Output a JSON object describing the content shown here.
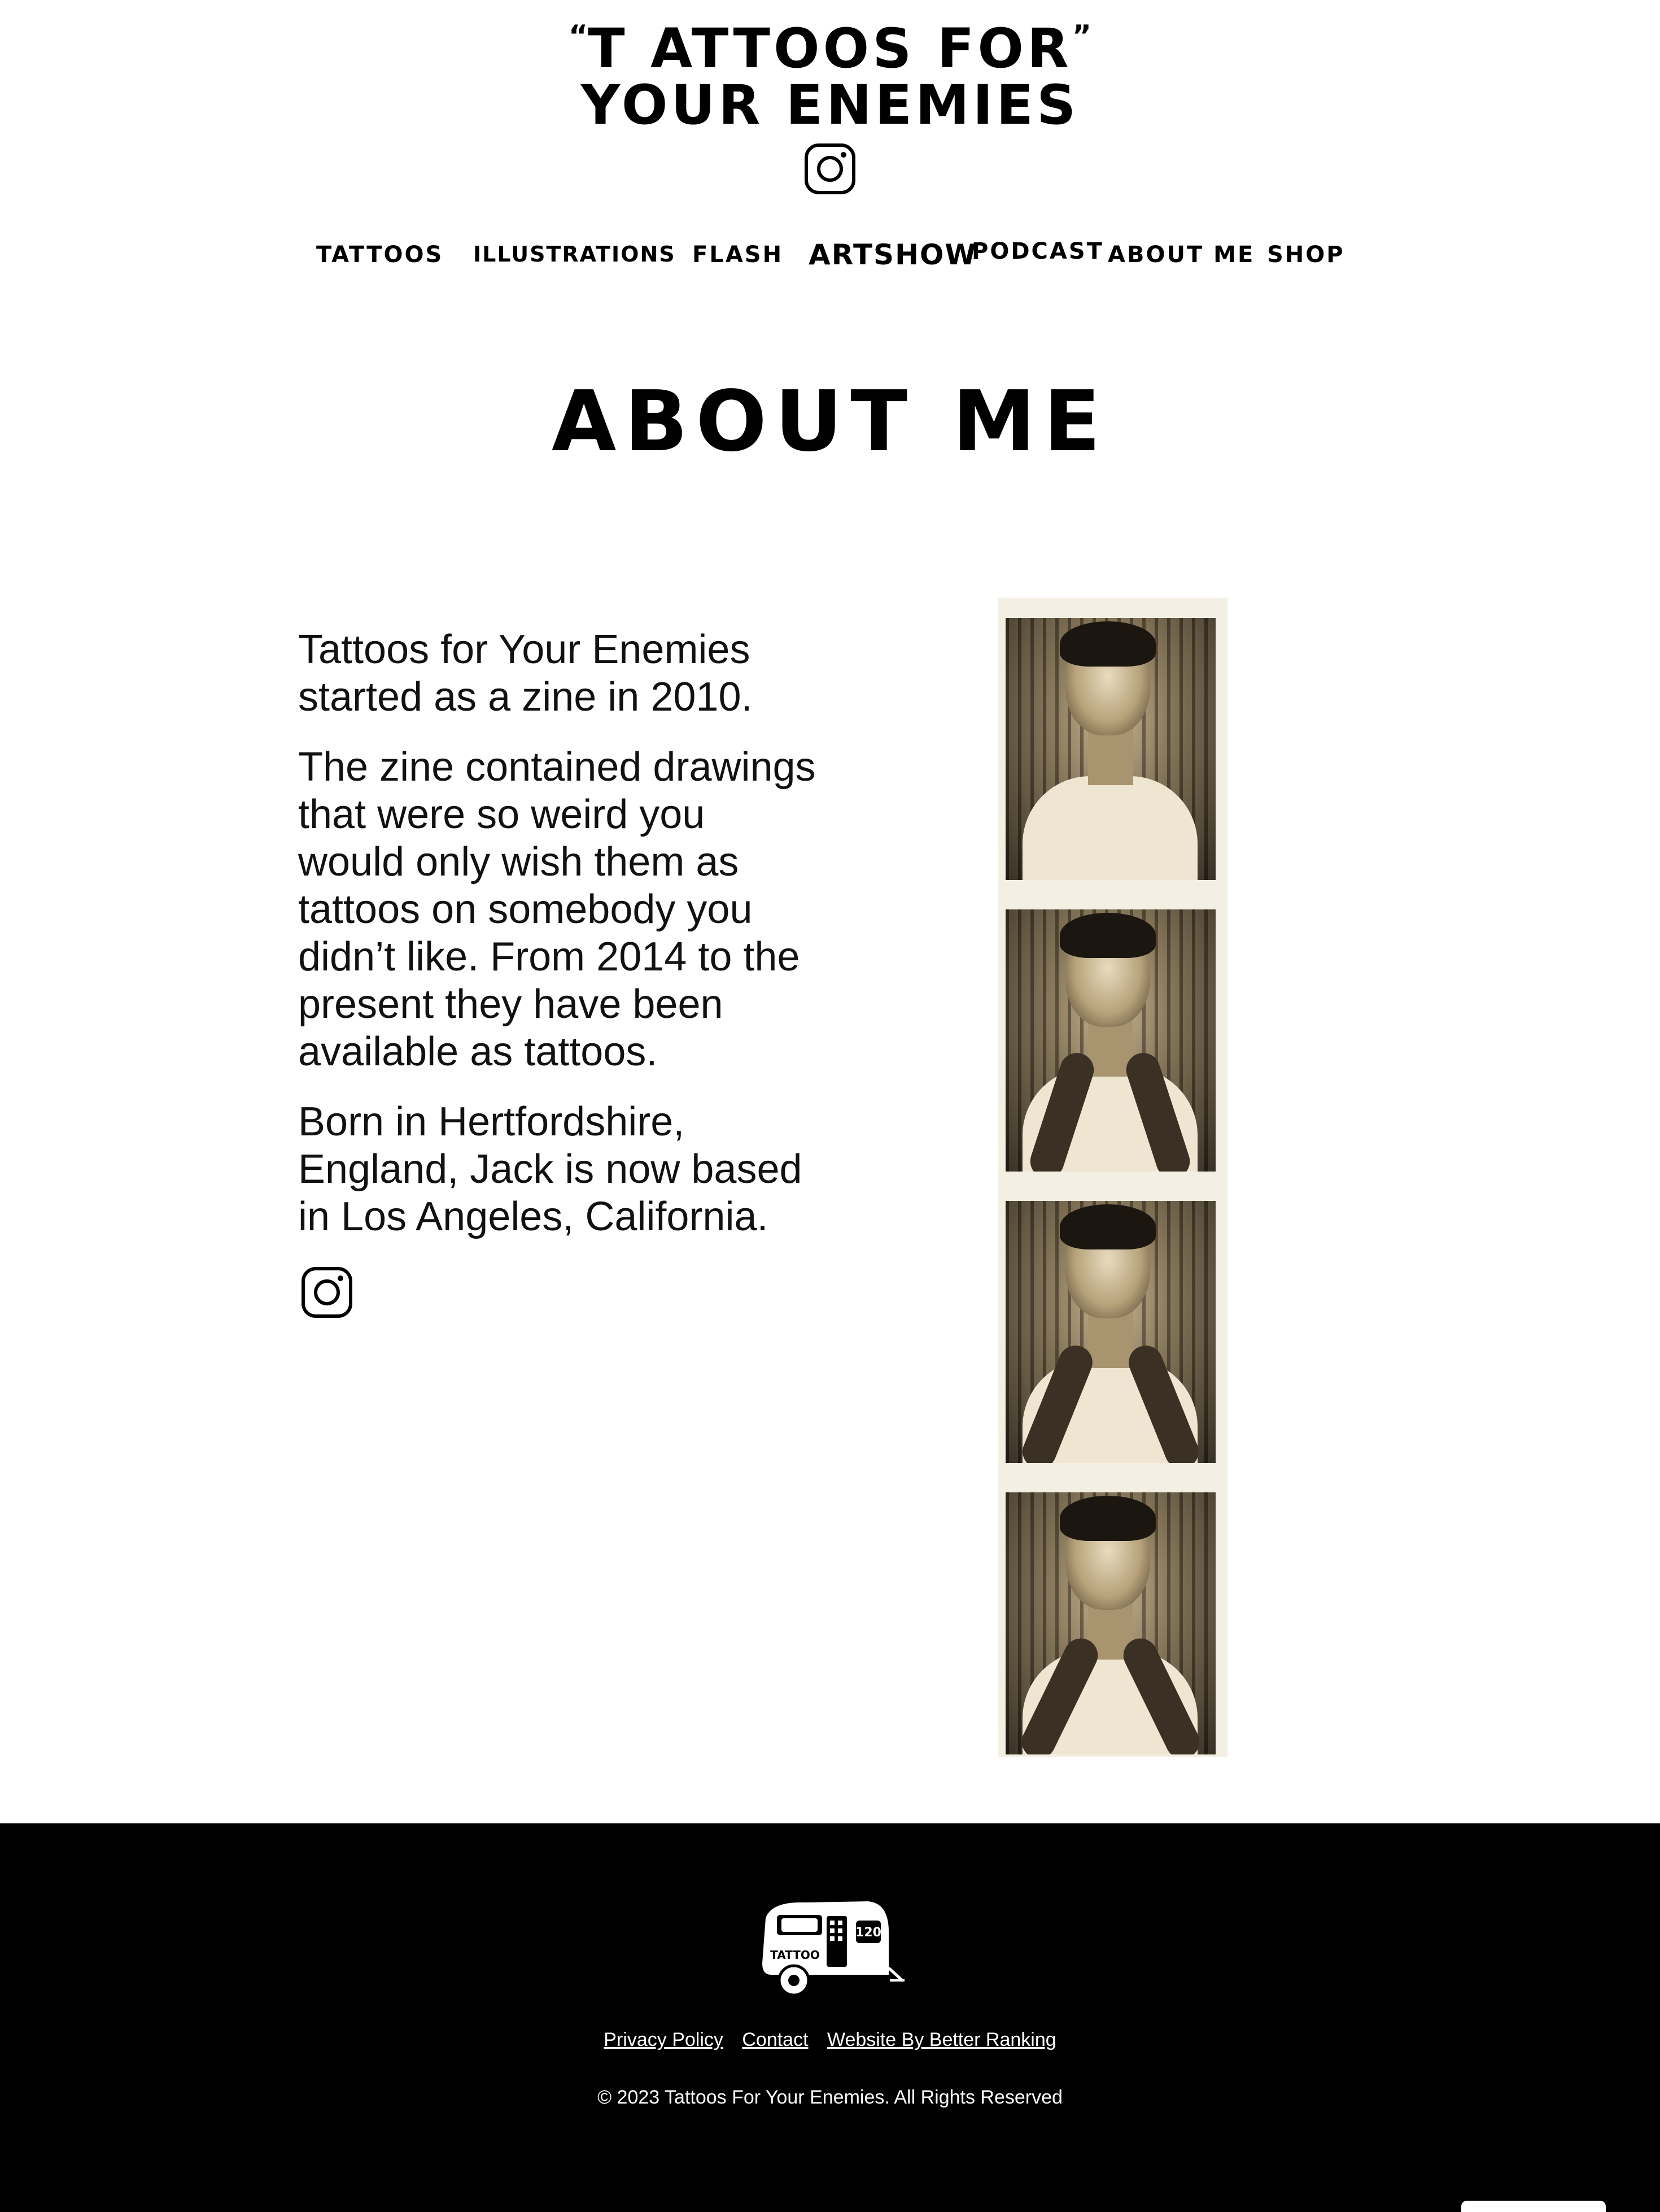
{
  "header": {
    "logo_line1": "T ATTOOS FOR",
    "logo_line2": "YOUR ENEMIES",
    "open_quote": "“",
    "close_quote": "”",
    "instagram_icon": "instagram-icon"
  },
  "nav": {
    "items": [
      {
        "label": "TATTOOS"
      },
      {
        "label": "ILLUSTRATIONS"
      },
      {
        "label": "FLASH"
      },
      {
        "label": "ARTSHOW"
      },
      {
        "label": "PODCAST"
      },
      {
        "label": "ABOUT ME"
      },
      {
        "label": "SHOP"
      }
    ]
  },
  "main": {
    "title": "ABOUT ME",
    "paragraphs": [
      "Tattoos for Your Enemies started as a zine in 2010.",
      "The zine contained drawings that were so weird you would only wish them as tattoos on somebody you didn’t like. From 2014 to the present they have been available as tattoos.",
      "Born in Hertfordshire, England, Jack is now based in Los Angeles, California."
    ],
    "instagram_icon": "instagram-icon",
    "photo_strip_frames": 4
  },
  "footer": {
    "logo_text": "TATTOO",
    "links": [
      {
        "label": "Privacy Policy"
      },
      {
        "label": "Contact"
      },
      {
        "label": "Website By Better Ranking"
      }
    ],
    "copyright": "© 2023 Tattoos For Your Enemies. All Rights Reserved"
  },
  "colors": {
    "background": "#ffffff",
    "text": "#111111",
    "footer_bg": "#000000",
    "footer_text": "#ffffff",
    "photo_tint": "#c9b48e"
  }
}
